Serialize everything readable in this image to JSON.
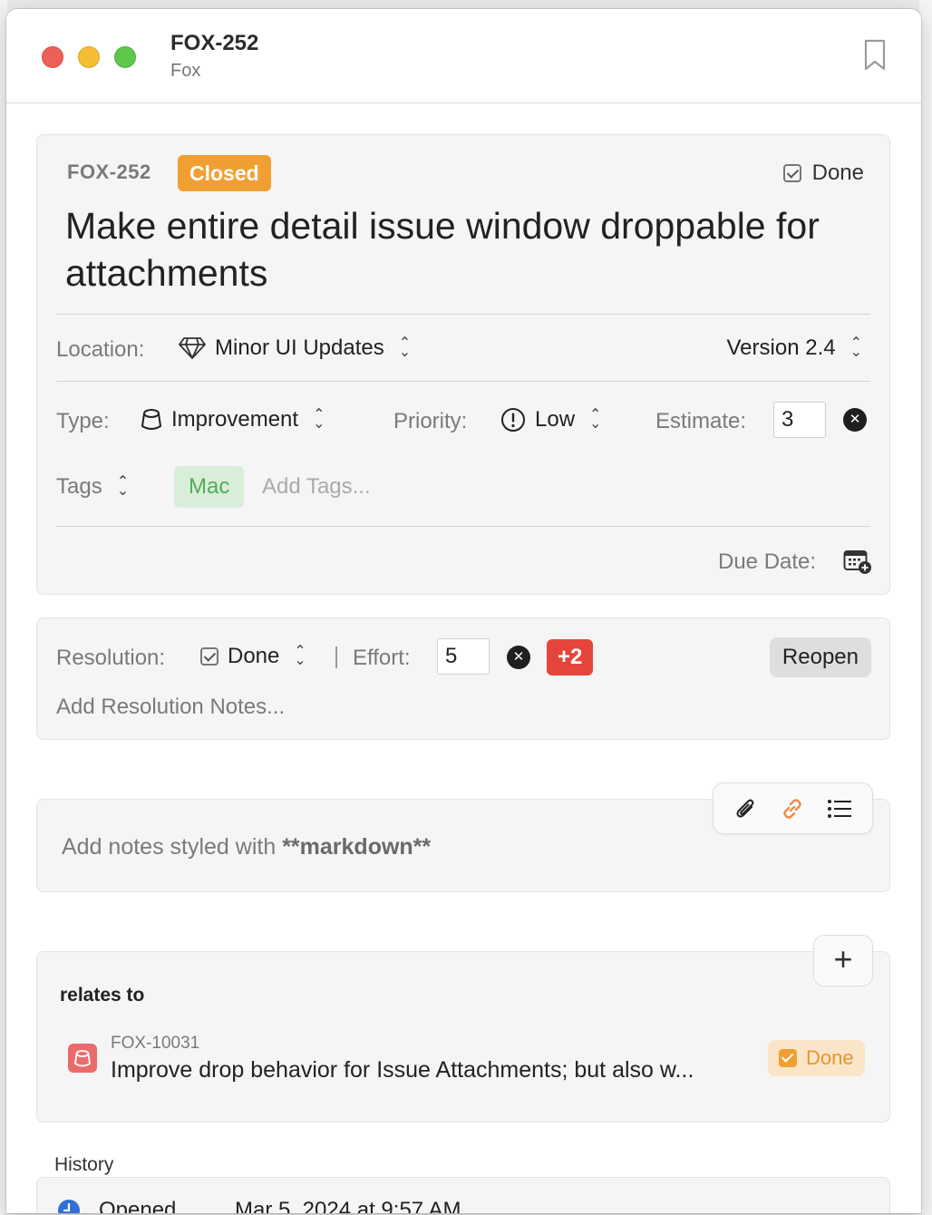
{
  "window": {
    "title": "FOX-252",
    "subtitle": "Fox"
  },
  "issue": {
    "key": "FOX-252",
    "status": "Closed",
    "done_label": "Done",
    "title": "Make entire detail issue window droppable for attachments",
    "location_label": "Location:",
    "location_value": "Minor UI Updates",
    "version_value": "Version 2.4",
    "type_label": "Type:",
    "type_value": "Improvement",
    "priority_label": "Priority:",
    "priority_value": "Low",
    "estimate_label": "Estimate:",
    "estimate_value": "3",
    "tags_label": "Tags",
    "tags": [
      "Mac"
    ],
    "tags_placeholder": "Add Tags...",
    "due_date_label": "Due Date:"
  },
  "resolution": {
    "label": "Resolution:",
    "value": "Done",
    "effort_label": "Effort:",
    "effort_value": "5",
    "effort_delta": "+2",
    "reopen_label": "Reopen",
    "notes_placeholder": "Add Resolution Notes..."
  },
  "notes": {
    "placeholder_prefix": "Add notes styled with ",
    "placeholder_bold": "**markdown**"
  },
  "relations": {
    "heading": "relates to",
    "items": [
      {
        "key": "FOX-10031",
        "title": "Improve drop behavior for Issue Attachments; but also w...",
        "status": "Done"
      }
    ]
  },
  "history": {
    "label": "History",
    "entries": [
      {
        "event": "Opened",
        "date": "Mar 5, 2024 at 9:57 AM"
      }
    ]
  },
  "colors": {
    "closed_badge": "#f0a033",
    "tag_mac_bg": "#d9eed9",
    "tag_mac_text": "#4fae55",
    "effort_badge": "#e5453a",
    "link_icon": "#f08a4b"
  }
}
